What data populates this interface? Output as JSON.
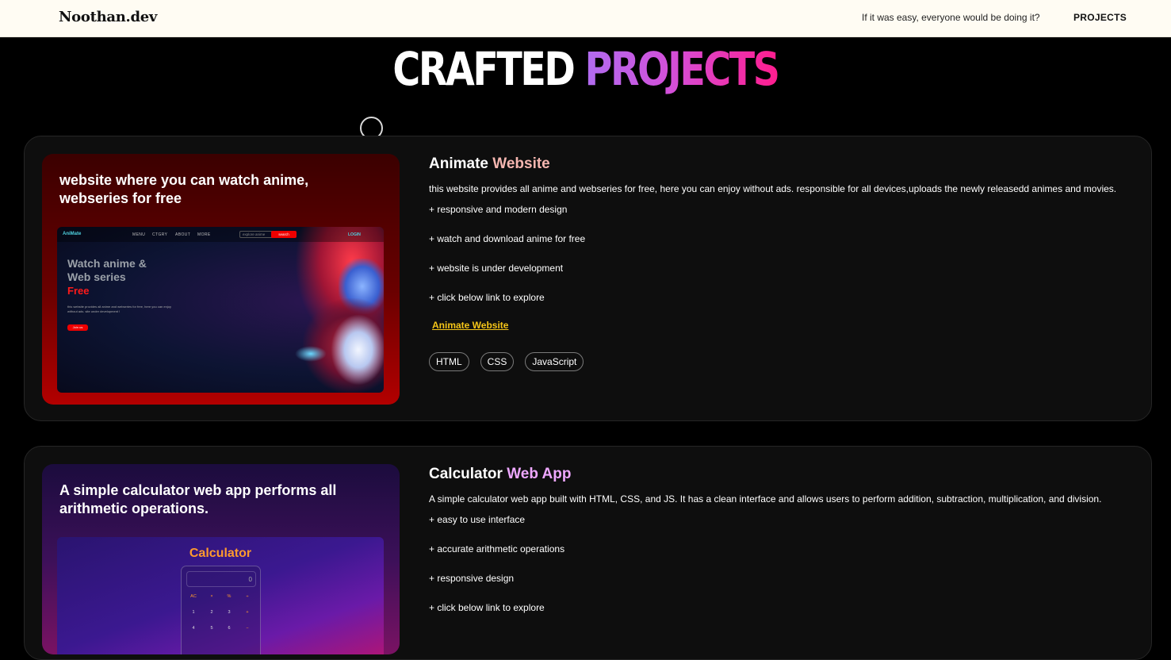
{
  "header": {
    "logo": "Noothan.dev",
    "tagline": "If it was easy, everyone would be doing it?",
    "nav_projects": "PROJECTS"
  },
  "hero": {
    "word1": "CRAFTED",
    "word2": "PROJECTS"
  },
  "projects": [
    {
      "thumb_title": "website where you can watch anime, webseries for free",
      "shot": {
        "logo": "AniMate",
        "menu": [
          "MENU",
          "CTGRY",
          "ABOUT",
          "MORE"
        ],
        "search_placeholder": "explore anime",
        "search_button": "search",
        "login": "LOGIN",
        "heading_line1": "Watch anime &",
        "heading_line2": "Web series",
        "free": "Free",
        "desc": "this website provides all anime and webseries for free, here you can enjoy without ads. site under development !",
        "join": "Join us"
      },
      "title_main": "Animate",
      "title_accent": "Website",
      "description": "this website provides all anime and webseries for free, here you can enjoy without ads. responsible for all devices,uploads the newly releasedd animes and movies.",
      "features": [
        "+ responsive and modern design",
        "+ watch and download anime for free",
        "+ website is under development",
        "+ click below link to explore"
      ],
      "link": "Animate Website",
      "tags": [
        "HTML",
        "CSS",
        "JavaScript"
      ]
    },
    {
      "thumb_title": "A simple calculator web app performs all arithmetic operations.",
      "shot": {
        "title": "Calculator",
        "display": "0",
        "keys": [
          "AC",
          "×",
          "%",
          "÷",
          "1",
          "2",
          "3",
          "+",
          "4",
          "5",
          "6",
          "−"
        ]
      },
      "title_main": "Calculator",
      "title_accent": "Web App",
      "description": "A simple calculator web app built with HTML, CSS, and JS. It has a clean interface and allows users to perform addition, subtraction, multiplication, and division.",
      "features": [
        "+ easy to use interface",
        "+ accurate arithmetic operations",
        "+ responsive design",
        "+ click below link to explore"
      ]
    }
  ]
}
